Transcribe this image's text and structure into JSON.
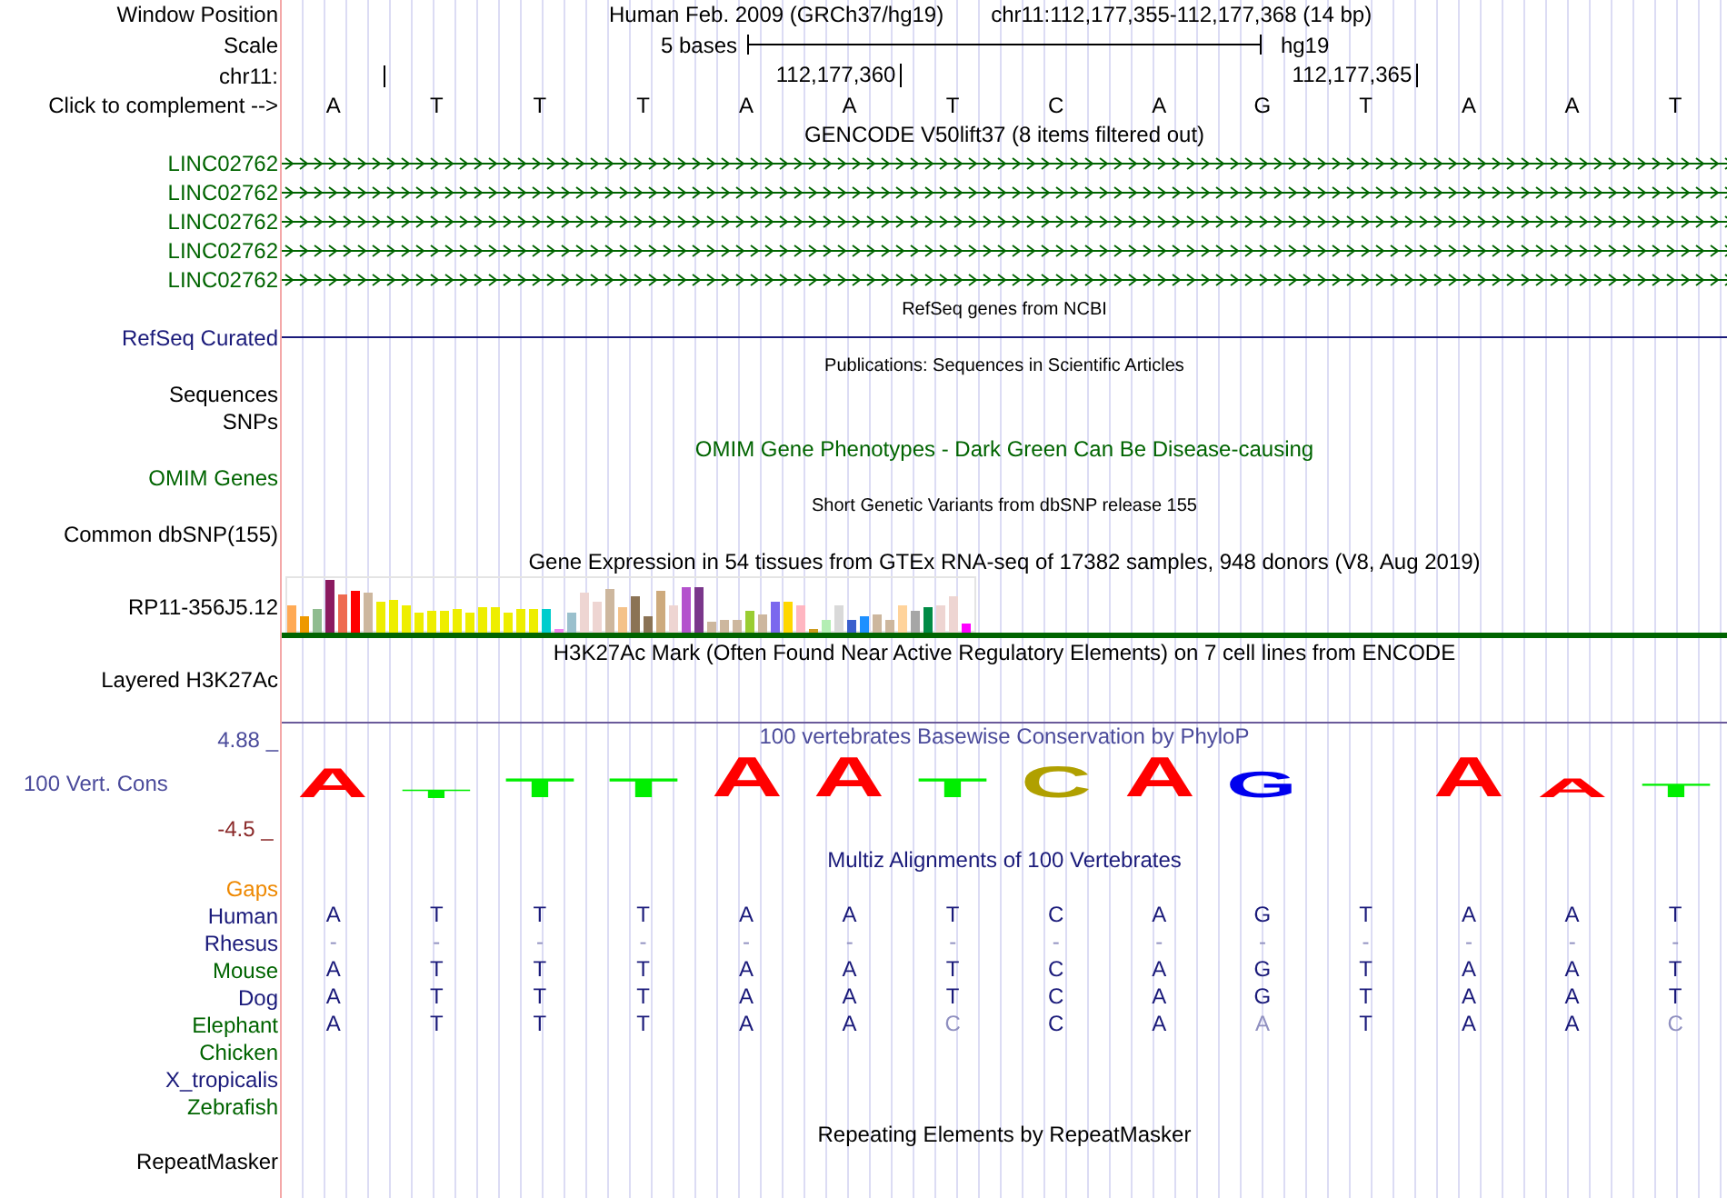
{
  "header": {
    "label": "Window Position",
    "assembly": "Human Feb. 2009 (GRCh37/hg19)",
    "position": "chr11:112,177,355-112,177,368 (14 bp)"
  },
  "scale": {
    "label": "Scale",
    "bar_label": "5 bases",
    "assembly": "hg19"
  },
  "ruler": {
    "label": "chr11:",
    "tick_labels": [
      "112,177,360",
      "112,177,365"
    ]
  },
  "complement": {
    "label": "Click to complement -->",
    "bases": [
      "A",
      "T",
      "T",
      "T",
      "A",
      "A",
      "T",
      "C",
      "A",
      "G",
      "T",
      "A",
      "A",
      "T"
    ]
  },
  "tracks": [
    {
      "kind": "title",
      "text": "GENCODE V50lift37 (8 items filtered out)",
      "small": false,
      "color": "#000000"
    },
    {
      "kind": "gene",
      "label": "LINC02762",
      "color": "#006400"
    },
    {
      "kind": "gene",
      "label": "LINC02762",
      "color": "#006400"
    },
    {
      "kind": "gene",
      "label": "LINC02762",
      "color": "#006400"
    },
    {
      "kind": "gene",
      "label": "LINC02762",
      "color": "#006400"
    },
    {
      "kind": "gene",
      "label": "LINC02762",
      "color": "#006400"
    },
    {
      "kind": "title",
      "text": "RefSeq genes from NCBI",
      "small": true,
      "color": "#000000"
    },
    {
      "kind": "line",
      "label": "RefSeq Curated",
      "color": "#1a1a7a"
    },
    {
      "kind": "title",
      "text": "Publications: Sequences in Scientific Articles",
      "small": true,
      "color": "#000000"
    },
    {
      "kind": "label",
      "label": "Sequences",
      "color": "#000000"
    },
    {
      "kind": "label",
      "label": "SNPs",
      "color": "#000000"
    },
    {
      "kind": "title",
      "text": "OMIM Gene Phenotypes - Dark Green Can Be Disease-causing",
      "small": false,
      "color": "#006400"
    },
    {
      "kind": "label",
      "label": "OMIM Genes",
      "color": "#006400"
    },
    {
      "kind": "title",
      "text": "Short Genetic Variants from dbSNP release 155",
      "small": true,
      "color": "#000000"
    },
    {
      "kind": "label",
      "label": "Common dbSNP(155)",
      "color": "#000000"
    },
    {
      "kind": "title",
      "text": "Gene Expression in 54 tissues from GTEx RNA-seq of 17382 samples, 948 donors (V8, Aug 2019)",
      "small": false,
      "color": "#000000"
    },
    {
      "kind": "expression",
      "label": "RP11-356J5.12",
      "color": "#000000"
    },
    {
      "kind": "title",
      "text": "H3K27Ac Mark (Often Found Near Active Regulatory Elements) on 7 cell lines from ENCODE",
      "small": false,
      "color": "#000000"
    },
    {
      "kind": "layered",
      "label": "Layered H3K27Ac",
      "color": "#000000"
    },
    {
      "kind": "conservation",
      "label": "100 Vert. Cons",
      "color": "#4b4b9b",
      "title": "100 vertebrates Basewise Conservation by PhyloP",
      "max": "4.88 _",
      "min": "-4.5 _",
      "letters": [
        "A",
        "T",
        "T",
        "T",
        "A",
        "A",
        "T",
        "C",
        "A",
        "G",
        "A",
        "A",
        "T"
      ]
    },
    {
      "kind": "title",
      "text": "Multiz Alignments of 100 Vertebrates",
      "small": false,
      "color": "#1a1a7a"
    },
    {
      "kind": "species",
      "label": "Gaps",
      "color": "#ee8800"
    },
    {
      "kind": "species",
      "label": "Human",
      "color": "#1a1a7a",
      "bases": [
        {
          "base": "A",
          "faded": false
        },
        {
          "base": "T",
          "faded": false
        },
        {
          "base": "T",
          "faded": false
        },
        {
          "base": "T",
          "faded": false
        },
        {
          "base": "A",
          "faded": false
        },
        {
          "base": "A",
          "faded": false
        },
        {
          "base": "T",
          "faded": false
        },
        {
          "base": "C",
          "faded": false
        },
        {
          "base": "A",
          "faded": false
        },
        {
          "base": "G",
          "faded": false
        },
        {
          "base": "T",
          "faded": false
        },
        {
          "base": "A",
          "faded": false
        },
        {
          "base": "A",
          "faded": false
        },
        {
          "base": "T",
          "faded": false
        }
      ]
    },
    {
      "kind": "species",
      "label": "Rhesus",
      "color": "#1a1a7a",
      "bases": [
        {
          "base": "-",
          "faded": true
        },
        {
          "base": "-",
          "faded": true
        },
        {
          "base": "-",
          "faded": true
        },
        {
          "base": "-",
          "faded": true
        },
        {
          "base": "-",
          "faded": true
        },
        {
          "base": "-",
          "faded": true
        },
        {
          "base": "-",
          "faded": true
        },
        {
          "base": "-",
          "faded": true
        },
        {
          "base": "-",
          "faded": true
        },
        {
          "base": "-",
          "faded": true
        },
        {
          "base": "-",
          "faded": true
        },
        {
          "base": "-",
          "faded": true
        },
        {
          "base": "-",
          "faded": true
        },
        {
          "base": "-",
          "faded": true
        }
      ]
    },
    {
      "kind": "species",
      "label": "Mouse",
      "color": "#006400",
      "bases": [
        {
          "base": "A",
          "faded": false
        },
        {
          "base": "T",
          "faded": false
        },
        {
          "base": "T",
          "faded": false
        },
        {
          "base": "T",
          "faded": false
        },
        {
          "base": "A",
          "faded": false
        },
        {
          "base": "A",
          "faded": false
        },
        {
          "base": "T",
          "faded": false
        },
        {
          "base": "C",
          "faded": false
        },
        {
          "base": "A",
          "faded": false
        },
        {
          "base": "G",
          "faded": false
        },
        {
          "base": "T",
          "faded": false
        },
        {
          "base": "A",
          "faded": false
        },
        {
          "base": "A",
          "faded": false
        },
        {
          "base": "T",
          "faded": false
        }
      ]
    },
    {
      "kind": "species",
      "label": "Dog",
      "color": "#1a1a7a",
      "bases": [
        {
          "base": "A",
          "faded": false
        },
        {
          "base": "T",
          "faded": false
        },
        {
          "base": "T",
          "faded": false
        },
        {
          "base": "T",
          "faded": false
        },
        {
          "base": "A",
          "faded": false
        },
        {
          "base": "A",
          "faded": false
        },
        {
          "base": "T",
          "faded": false
        },
        {
          "base": "C",
          "faded": false
        },
        {
          "base": "A",
          "faded": false
        },
        {
          "base": "G",
          "faded": false
        },
        {
          "base": "T",
          "faded": false
        },
        {
          "base": "A",
          "faded": false
        },
        {
          "base": "A",
          "faded": false
        },
        {
          "base": "T",
          "faded": false
        }
      ]
    },
    {
      "kind": "species",
      "label": "Elephant",
      "color": "#006400",
      "bases": [
        {
          "base": "A",
          "faded": false
        },
        {
          "base": "T",
          "faded": false
        },
        {
          "base": "T",
          "faded": false
        },
        {
          "base": "T",
          "faded": false
        },
        {
          "base": "A",
          "faded": false
        },
        {
          "base": "A",
          "faded": false
        },
        {
          "base": "C",
          "faded": true
        },
        {
          "base": "C",
          "faded": false
        },
        {
          "base": "A",
          "faded": false
        },
        {
          "base": "A",
          "faded": true
        },
        {
          "base": "T",
          "faded": false
        },
        {
          "base": "A",
          "faded": false
        },
        {
          "base": "A",
          "faded": false
        },
        {
          "base": "C",
          "faded": true
        }
      ]
    },
    {
      "kind": "species",
      "label": "Chicken",
      "color": "#006400"
    },
    {
      "kind": "species",
      "label": "X_tropicalis",
      "color": "#1a1a7a"
    },
    {
      "kind": "species",
      "label": "Zebrafish",
      "color": "#006400"
    },
    {
      "kind": "title",
      "text": "Repeating Elements by RepeatMasker",
      "small": false,
      "color": "#000000"
    },
    {
      "kind": "label",
      "label": "RepeatMasker",
      "color": "#000000"
    }
  ]
}
